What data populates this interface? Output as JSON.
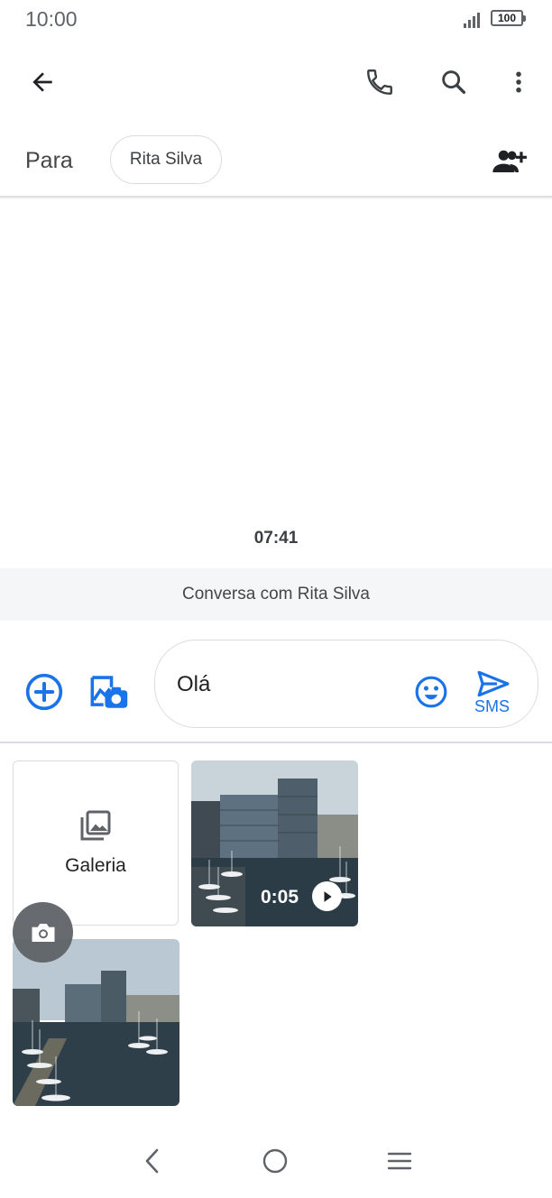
{
  "status_bar": {
    "time": "10:00",
    "battery": "100"
  },
  "top_bar": {
    "back_icon": "arrow-back-icon",
    "call_icon": "phone-icon",
    "search_icon": "search-icon",
    "more_icon": "more-vert-icon"
  },
  "recipients": {
    "to_label": "Para",
    "chip_name": "Rita Silva",
    "add_icon": "group-add-icon"
  },
  "conversation": {
    "timestamp": "07:41",
    "banner": "Conversa com Rita Silva"
  },
  "composer": {
    "add_icon": "add-circle-icon",
    "media_icon": "camera-gallery-icon",
    "text": "Olá",
    "emoji_icon": "emoji-icon",
    "send_icon": "send-icon",
    "send_label": "SMS",
    "accent": "#1a73e8"
  },
  "media_picker": {
    "gallery_label": "Galeria",
    "video_duration": "0:05",
    "camera_icon": "camera-icon"
  },
  "nav_bar": {
    "back": "nav-back-icon",
    "home": "nav-home-icon",
    "menu": "nav-menu-icon"
  }
}
